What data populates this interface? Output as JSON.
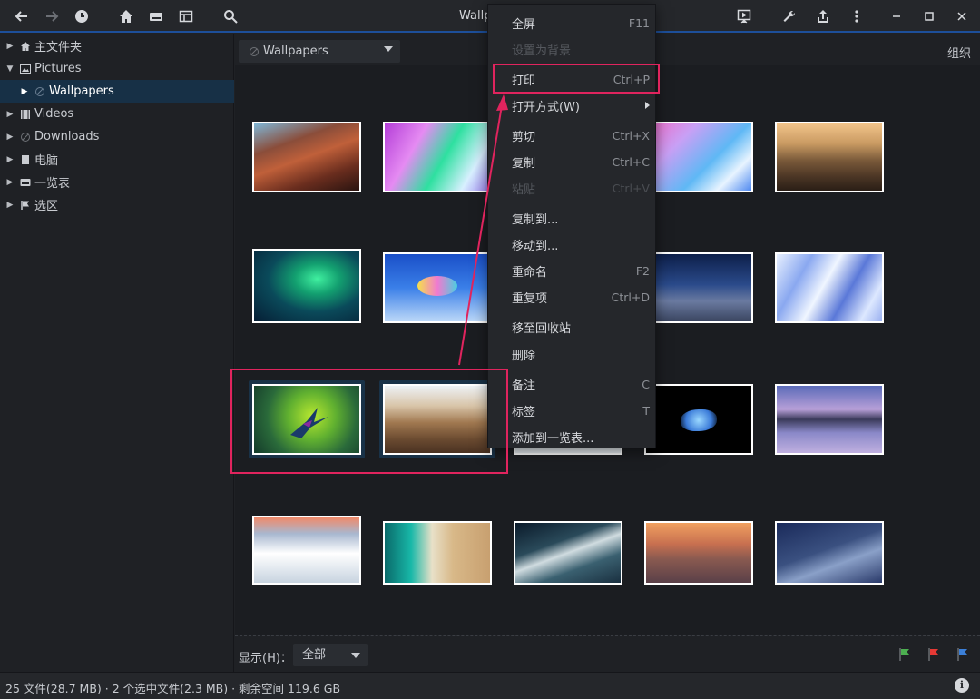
{
  "window": {
    "title": "Wallp"
  },
  "toolbar": {
    "buttons": [
      "back-icon",
      "forward-icon",
      "history-icon",
      "home-icon",
      "drive-icon",
      "browser-icon",
      "search-icon",
      "slideshow-icon",
      "tools-icon",
      "share-icon",
      "menu-icon",
      "minimize-icon",
      "maximize-icon",
      "close-icon"
    ]
  },
  "sidebar": {
    "items": [
      {
        "label": "主文件夹",
        "icon": "home-icon",
        "expanded": false
      },
      {
        "label": "Pictures",
        "icon": "pictures-icon",
        "expanded": true
      },
      {
        "label": "Wallpapers",
        "icon": "folder-icon",
        "expanded": false,
        "selected": true
      },
      {
        "label": "Videos",
        "icon": "video-icon",
        "expanded": false
      },
      {
        "label": "Downloads",
        "icon": "folder-icon",
        "expanded": false
      },
      {
        "label": "电脑",
        "icon": "computer-icon",
        "expanded": false
      },
      {
        "label": "一览表",
        "icon": "catalog-icon",
        "expanded": false
      },
      {
        "label": "选区",
        "icon": "flag-icon",
        "expanded": false
      }
    ]
  },
  "location": {
    "current": "Wallpapers",
    "organize_label": "组织"
  },
  "filter": {
    "label": "显示(H)：",
    "value": "全部"
  },
  "status": {
    "text": "25 文件(28.7 MB) · 2 个选中文件(2.3 MB) · 剩余空间 119.6 GB"
  },
  "context_menu": {
    "items": [
      {
        "label": "全屏",
        "shortcut": "F11",
        "enabled": true
      },
      {
        "label": "设置为背景",
        "shortcut": "",
        "enabled": false
      },
      {
        "label": "打印",
        "shortcut": "Ctrl+P",
        "enabled": true,
        "highlighted": true
      },
      {
        "label": "打开方式(W)",
        "shortcut": "",
        "enabled": true,
        "submenu": true
      },
      {
        "label": "剪切",
        "shortcut": "Ctrl+X",
        "enabled": true
      },
      {
        "label": "复制",
        "shortcut": "Ctrl+C",
        "enabled": true
      },
      {
        "label": "粘贴",
        "shortcut": "Ctrl+V",
        "enabled": false
      },
      {
        "label": "复制到...",
        "shortcut": "",
        "enabled": true
      },
      {
        "label": "移动到...",
        "shortcut": "",
        "enabled": true
      },
      {
        "label": "重命名",
        "shortcut": "F2",
        "enabled": true
      },
      {
        "label": "重复项",
        "shortcut": "Ctrl+D",
        "enabled": true
      },
      {
        "label": "移至回收站",
        "shortcut": "",
        "enabled": true
      },
      {
        "label": "删除",
        "shortcut": "",
        "enabled": true
      },
      {
        "label": "备注",
        "shortcut": "C",
        "enabled": true
      },
      {
        "label": "标签",
        "shortcut": "T",
        "enabled": true
      },
      {
        "label": "添加到一览表...",
        "shortcut": "",
        "enabled": true
      }
    ]
  },
  "colors": {
    "accent": "#1d4f9a",
    "annotation": "#e0245e",
    "selection": "#173046"
  },
  "thumbnails": {
    "count": 20,
    "selected_count": 2
  }
}
